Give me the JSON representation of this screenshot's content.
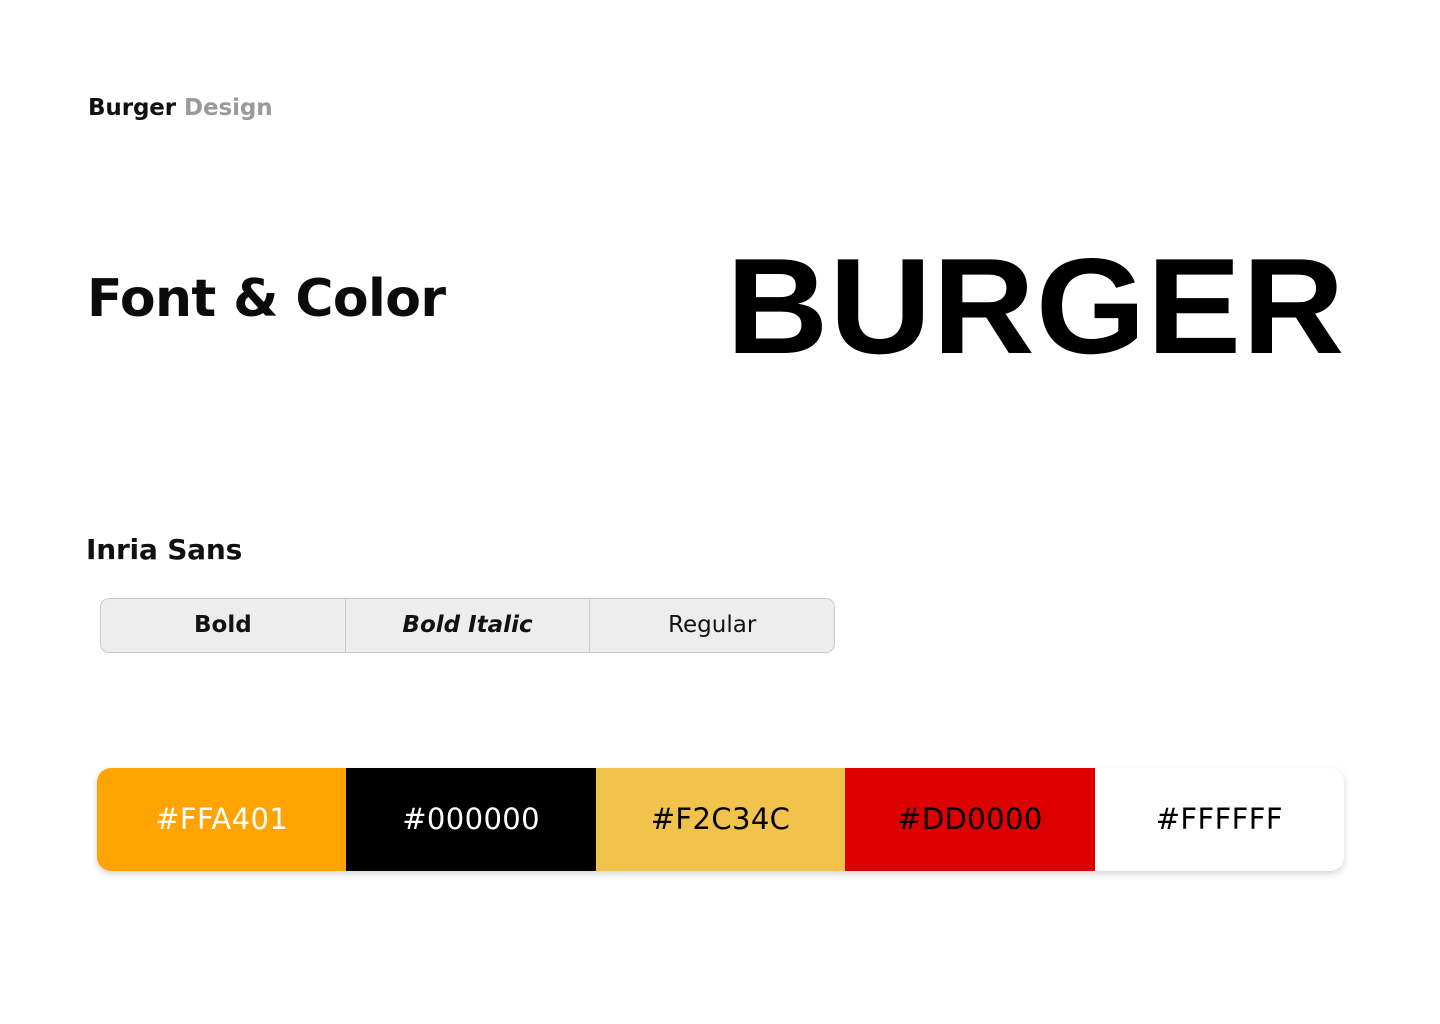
{
  "page": {
    "background_color": "#FFFFFF"
  },
  "brand": {
    "primary_word": "Burger",
    "secondary_word": "Design",
    "primary_color": "#111111",
    "secondary_color": "#9A9A9A"
  },
  "section": {
    "title": "Font & Color"
  },
  "wordmark": {
    "text": "BURGER",
    "color": "#000000"
  },
  "typeface": {
    "name": "Inria Sans",
    "styles": [
      {
        "label": "Bold",
        "weight": "bold",
        "style": "normal"
      },
      {
        "label": "Bold Italic",
        "weight": "bold",
        "style": "italic"
      },
      {
        "label": "Regular",
        "weight": "normal",
        "style": "normal"
      }
    ],
    "bar_background": "#EDEDED",
    "bar_border_color": "#C9C9C9"
  },
  "palette": {
    "swatches": [
      {
        "hex": "#FFA401",
        "label": "#FFA401",
        "text_color": "#FFFFFF"
      },
      {
        "hex": "#000000",
        "label": "#000000",
        "text_color": "#FFFFFF"
      },
      {
        "hex": "#F2C34C",
        "label": "#F2C34C",
        "text_color": "#000000"
      },
      {
        "hex": "#DD0000",
        "label": "#DD0000",
        "text_color": "#000000"
      },
      {
        "hex": "#FFFFFF",
        "label": "#FFFFFF",
        "text_color": "#000000"
      }
    ]
  }
}
